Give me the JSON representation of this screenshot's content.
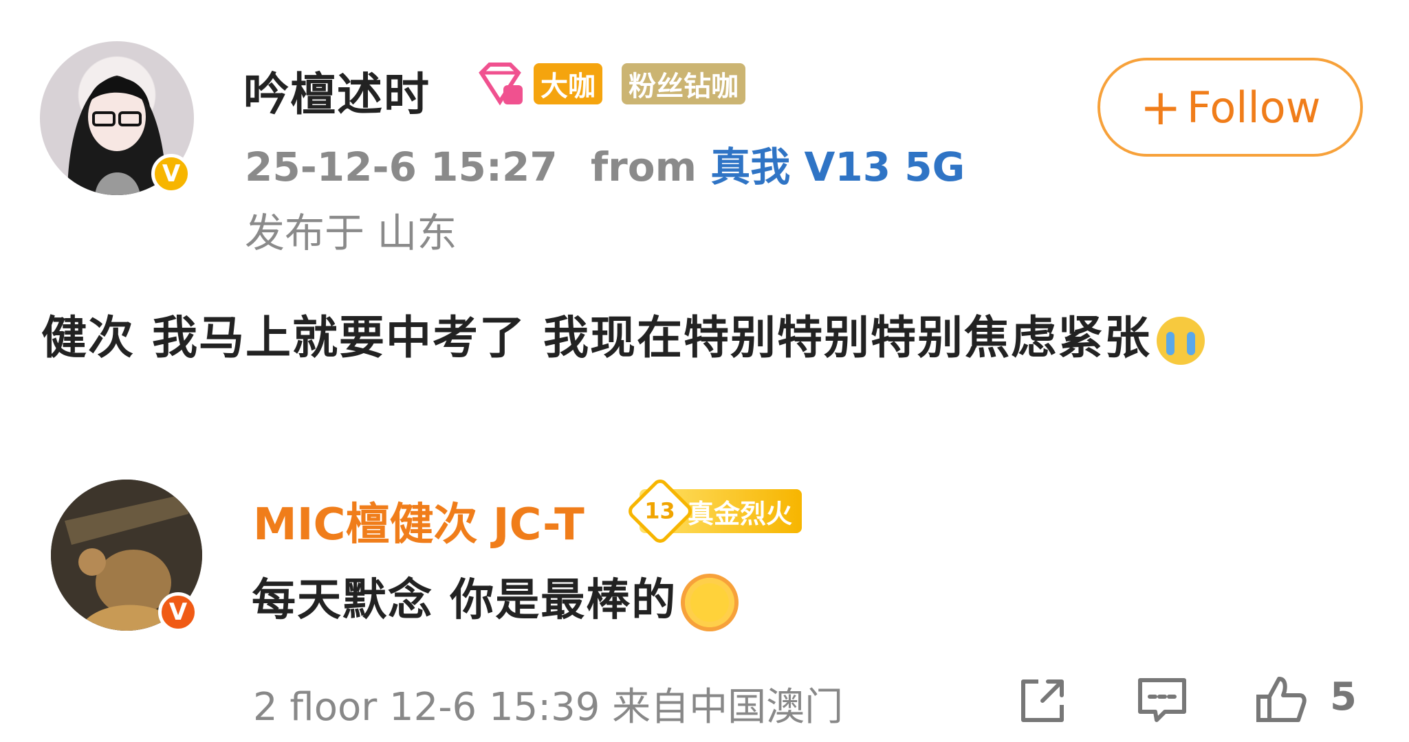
{
  "post": {
    "author": "吟檀述时",
    "badges": {
      "daka": "大咖",
      "fans": "粉丝钻咖"
    },
    "timestamp": "25-12-6 15:27",
    "from_label": "from",
    "device": "真我 V13 5G",
    "location": "发布于 山东",
    "text": "健次 我马上就要中考了 我现在特别特别特别焦虑紧张",
    "follow_label": "Follow",
    "verify_mark": "V"
  },
  "comment": {
    "author": "MIC檀健次 JC-T",
    "level_number": "13",
    "level_badge": "真金烈火",
    "text": "每天默念 你是最棒的",
    "meta": "2 floor 12-6 15:39 来自中国澳门",
    "like_count": "5",
    "verify_mark": "V"
  },
  "icons": {
    "diamond": "diamond-icon",
    "crying": "crying-emoji-icon",
    "sun": "sun-emoji-icon",
    "share": "share-icon",
    "comment": "comment-icon",
    "like": "thumbs-up-icon"
  },
  "colors": {
    "follow_orange": "#f07d1a",
    "device_blue": "#2f74c5",
    "badge_gold": "#f5a40e",
    "badge_fans": "#cbb472"
  }
}
